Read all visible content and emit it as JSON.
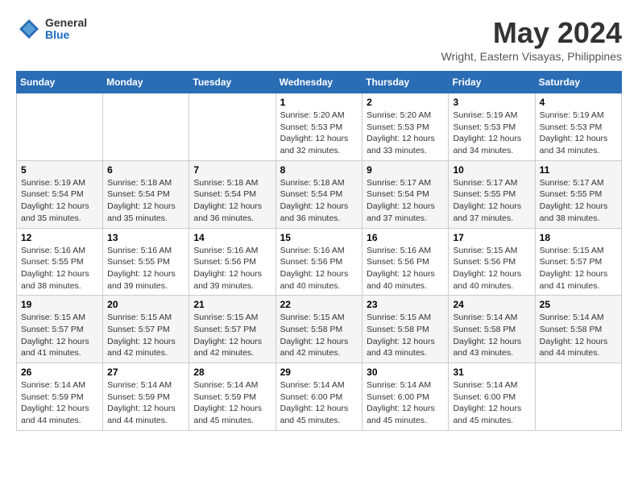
{
  "logo": {
    "general": "General",
    "blue": "Blue"
  },
  "title": "May 2024",
  "location": "Wright, Eastern Visayas, Philippines",
  "days_of_week": [
    "Sunday",
    "Monday",
    "Tuesday",
    "Wednesday",
    "Thursday",
    "Friday",
    "Saturday"
  ],
  "weeks": [
    [
      {
        "day": "",
        "info": ""
      },
      {
        "day": "",
        "info": ""
      },
      {
        "day": "",
        "info": ""
      },
      {
        "day": "1",
        "info": "Sunrise: 5:20 AM\nSunset: 5:53 PM\nDaylight: 12 hours\nand 32 minutes."
      },
      {
        "day": "2",
        "info": "Sunrise: 5:20 AM\nSunset: 5:53 PM\nDaylight: 12 hours\nand 33 minutes."
      },
      {
        "day": "3",
        "info": "Sunrise: 5:19 AM\nSunset: 5:53 PM\nDaylight: 12 hours\nand 34 minutes."
      },
      {
        "day": "4",
        "info": "Sunrise: 5:19 AM\nSunset: 5:53 PM\nDaylight: 12 hours\nand 34 minutes."
      }
    ],
    [
      {
        "day": "5",
        "info": "Sunrise: 5:19 AM\nSunset: 5:54 PM\nDaylight: 12 hours\nand 35 minutes."
      },
      {
        "day": "6",
        "info": "Sunrise: 5:18 AM\nSunset: 5:54 PM\nDaylight: 12 hours\nand 35 minutes."
      },
      {
        "day": "7",
        "info": "Sunrise: 5:18 AM\nSunset: 5:54 PM\nDaylight: 12 hours\nand 36 minutes."
      },
      {
        "day": "8",
        "info": "Sunrise: 5:18 AM\nSunset: 5:54 PM\nDaylight: 12 hours\nand 36 minutes."
      },
      {
        "day": "9",
        "info": "Sunrise: 5:17 AM\nSunset: 5:54 PM\nDaylight: 12 hours\nand 37 minutes."
      },
      {
        "day": "10",
        "info": "Sunrise: 5:17 AM\nSunset: 5:55 PM\nDaylight: 12 hours\nand 37 minutes."
      },
      {
        "day": "11",
        "info": "Sunrise: 5:17 AM\nSunset: 5:55 PM\nDaylight: 12 hours\nand 38 minutes."
      }
    ],
    [
      {
        "day": "12",
        "info": "Sunrise: 5:16 AM\nSunset: 5:55 PM\nDaylight: 12 hours\nand 38 minutes."
      },
      {
        "day": "13",
        "info": "Sunrise: 5:16 AM\nSunset: 5:55 PM\nDaylight: 12 hours\nand 39 minutes."
      },
      {
        "day": "14",
        "info": "Sunrise: 5:16 AM\nSunset: 5:56 PM\nDaylight: 12 hours\nand 39 minutes."
      },
      {
        "day": "15",
        "info": "Sunrise: 5:16 AM\nSunset: 5:56 PM\nDaylight: 12 hours\nand 40 minutes."
      },
      {
        "day": "16",
        "info": "Sunrise: 5:16 AM\nSunset: 5:56 PM\nDaylight: 12 hours\nand 40 minutes."
      },
      {
        "day": "17",
        "info": "Sunrise: 5:15 AM\nSunset: 5:56 PM\nDaylight: 12 hours\nand 40 minutes."
      },
      {
        "day": "18",
        "info": "Sunrise: 5:15 AM\nSunset: 5:57 PM\nDaylight: 12 hours\nand 41 minutes."
      }
    ],
    [
      {
        "day": "19",
        "info": "Sunrise: 5:15 AM\nSunset: 5:57 PM\nDaylight: 12 hours\nand 41 minutes."
      },
      {
        "day": "20",
        "info": "Sunrise: 5:15 AM\nSunset: 5:57 PM\nDaylight: 12 hours\nand 42 minutes."
      },
      {
        "day": "21",
        "info": "Sunrise: 5:15 AM\nSunset: 5:57 PM\nDaylight: 12 hours\nand 42 minutes."
      },
      {
        "day": "22",
        "info": "Sunrise: 5:15 AM\nSunset: 5:58 PM\nDaylight: 12 hours\nand 42 minutes."
      },
      {
        "day": "23",
        "info": "Sunrise: 5:15 AM\nSunset: 5:58 PM\nDaylight: 12 hours\nand 43 minutes."
      },
      {
        "day": "24",
        "info": "Sunrise: 5:14 AM\nSunset: 5:58 PM\nDaylight: 12 hours\nand 43 minutes."
      },
      {
        "day": "25",
        "info": "Sunrise: 5:14 AM\nSunset: 5:58 PM\nDaylight: 12 hours\nand 44 minutes."
      }
    ],
    [
      {
        "day": "26",
        "info": "Sunrise: 5:14 AM\nSunset: 5:59 PM\nDaylight: 12 hours\nand 44 minutes."
      },
      {
        "day": "27",
        "info": "Sunrise: 5:14 AM\nSunset: 5:59 PM\nDaylight: 12 hours\nand 44 minutes."
      },
      {
        "day": "28",
        "info": "Sunrise: 5:14 AM\nSunset: 5:59 PM\nDaylight: 12 hours\nand 45 minutes."
      },
      {
        "day": "29",
        "info": "Sunrise: 5:14 AM\nSunset: 6:00 PM\nDaylight: 12 hours\nand 45 minutes."
      },
      {
        "day": "30",
        "info": "Sunrise: 5:14 AM\nSunset: 6:00 PM\nDaylight: 12 hours\nand 45 minutes."
      },
      {
        "day": "31",
        "info": "Sunrise: 5:14 AM\nSunset: 6:00 PM\nDaylight: 12 hours\nand 45 minutes."
      },
      {
        "day": "",
        "info": ""
      }
    ]
  ]
}
